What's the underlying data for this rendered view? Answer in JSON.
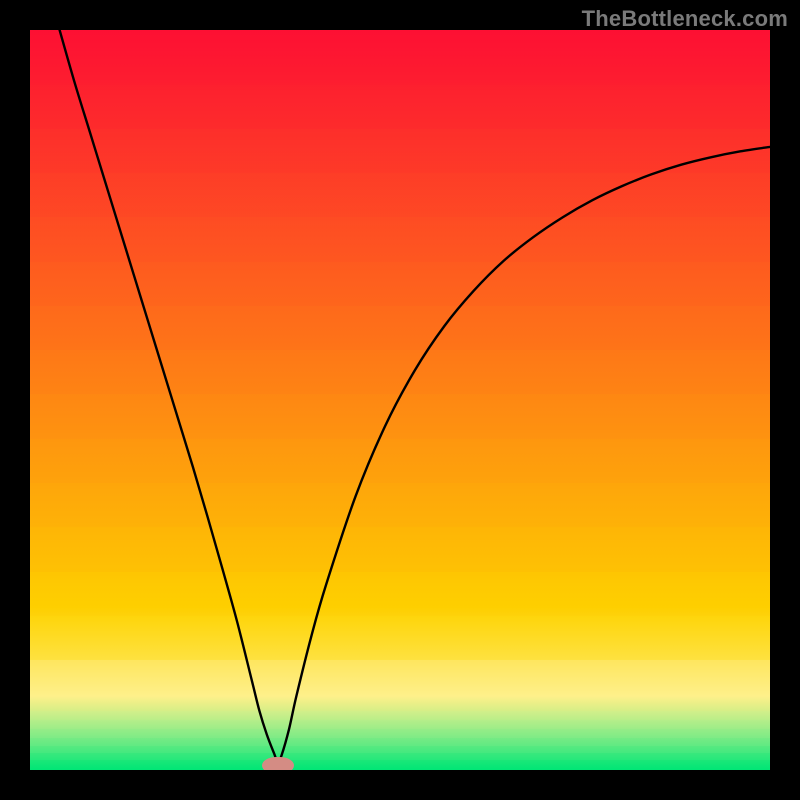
{
  "watermark_text": "TheBottleneck.com",
  "chart_data": {
    "type": "line",
    "title": "",
    "xlabel": "",
    "ylabel": "",
    "xlim": [
      0,
      100
    ],
    "ylim": [
      0,
      100
    ],
    "grid": false,
    "legend": false,
    "background_gradient": {
      "top_color": "#fd1033",
      "middle_color": "#fecf00",
      "bottom_color": "#00e676",
      "type": "smooth-rainbow"
    },
    "series": [
      {
        "name": "bottleneck-curve",
        "color": "#000000",
        "stroke_width": 2.4,
        "x": [
          4,
          6,
          8,
          10,
          12,
          14,
          16,
          18,
          20,
          22,
          24,
          26,
          28,
          30,
          31,
          32,
          33,
          33.5,
          34,
          35,
          36,
          38,
          40,
          44,
          48,
          52,
          56,
          60,
          64,
          68,
          72,
          76,
          80,
          84,
          88,
          92,
          96,
          100
        ],
        "y": [
          100,
          93,
          86.5,
          80,
          73.5,
          67,
          60.5,
          54,
          47.5,
          41,
          34.2,
          27.2,
          20,
          12,
          8,
          4.8,
          2.2,
          1.0,
          2.0,
          5.5,
          10,
          18,
          25,
          37,
          46.5,
          54,
          60,
          64.8,
          68.8,
          72,
          74.7,
          77,
          78.9,
          80.5,
          81.8,
          82.8,
          83.6,
          84.2
        ]
      }
    ],
    "marker": {
      "name": "optimal-point",
      "x": 33.5,
      "y": 0.6,
      "color": "#d48c84",
      "rx": 2.2,
      "ry": 1.1
    },
    "gradient_rows": [
      {
        "h": 8.0,
        "c": "#fd1033"
      },
      {
        "h": 6.5,
        "c": "#fd1a31"
      },
      {
        "h": 6.5,
        "c": "#fd2a2d"
      },
      {
        "h": 6.5,
        "c": "#fd3a29"
      },
      {
        "h": 6.5,
        "c": "#fd4a25"
      },
      {
        "h": 6.5,
        "c": "#fe5a20"
      },
      {
        "h": 6.5,
        "c": "#fe6b1b"
      },
      {
        "h": 6.5,
        "c": "#fe7b16"
      },
      {
        "h": 6.5,
        "c": "#fe8b11"
      },
      {
        "h": 6.5,
        "c": "#fe9b0c"
      },
      {
        "h": 6.5,
        "c": "#feab07"
      },
      {
        "h": 6.5,
        "c": "#febb03"
      },
      {
        "h": 6.5,
        "c": "#fecf00"
      },
      {
        "h": 6.5,
        "c": "#fede00"
      },
      {
        "h": 7.5,
        "c": "#fef08a"
      },
      {
        "h": 1.3,
        "c": "#ecf29a"
      },
      {
        "h": 1.3,
        "c": "#d6f0a0"
      },
      {
        "h": 1.3,
        "c": "#b8ee9e"
      },
      {
        "h": 1.2,
        "c": "#92ec98"
      },
      {
        "h": 1.1,
        "c": "#66ea8e"
      },
      {
        "h": 1.0,
        "c": "#33e882"
      },
      {
        "h": 1.4,
        "c": "#00e676"
      }
    ]
  }
}
